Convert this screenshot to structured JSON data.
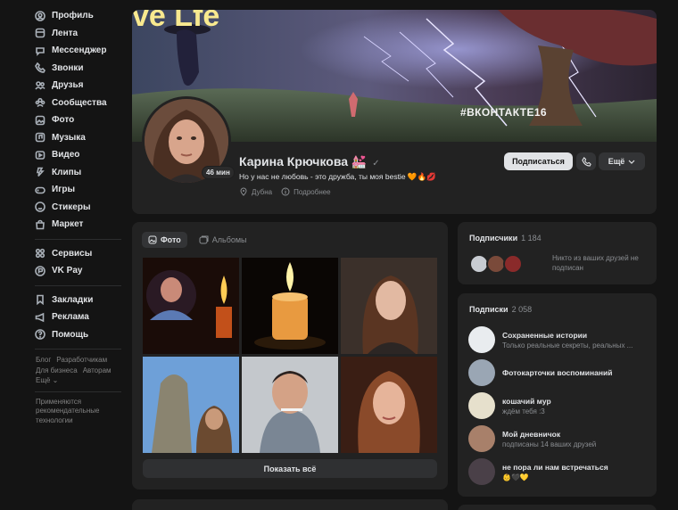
{
  "sidebar": {
    "items": [
      {
        "label": "Профиль",
        "icon": "user-circle-icon"
      },
      {
        "label": "Лента",
        "icon": "feed-icon"
      },
      {
        "label": "Мессенджер",
        "icon": "chat-icon"
      },
      {
        "label": "Звонки",
        "icon": "phone-icon"
      },
      {
        "label": "Друзья",
        "icon": "friends-icon"
      },
      {
        "label": "Сообщества",
        "icon": "communities-icon"
      },
      {
        "label": "Фото",
        "icon": "photo-icon"
      },
      {
        "label": "Музыка",
        "icon": "music-icon"
      },
      {
        "label": "Видео",
        "icon": "video-icon"
      },
      {
        "label": "Клипы",
        "icon": "clips-icon"
      },
      {
        "label": "Игры",
        "icon": "gamepad-icon"
      },
      {
        "label": "Стикеры",
        "icon": "sticker-icon"
      },
      {
        "label": "Маркет",
        "icon": "bag-icon"
      }
    ],
    "items2": [
      {
        "label": "Сервисы",
        "icon": "services-icon"
      },
      {
        "label": "VK Pay",
        "icon": "vkpay-icon"
      }
    ],
    "items3": [
      {
        "label": "Закладки",
        "icon": "bookmark-icon"
      },
      {
        "label": "Реклама",
        "icon": "megaphone-icon"
      },
      {
        "label": "Помощь",
        "icon": "help-icon"
      }
    ],
    "links": {
      "blog": "Блог",
      "developers": "Разработчикам",
      "business": "Для бизнеса",
      "authors": "Авторам",
      "more": "Ещё ⌄"
    },
    "note": "Применяются рекомендательные технологии"
  },
  "profile": {
    "cover_hashtag": "#ВКОНТАКТЕ16",
    "cover_text": "ve  Lfe",
    "online_badge": "46 мин",
    "name": "Карина Крючкова 💒",
    "verified_mark": "✓",
    "status": "Но у нас не любовь - это дружба, ты моя bestie 🧡🔥💋",
    "city": "Дубна",
    "details": "Подробнее",
    "subscribe_button": "Подписаться",
    "more_button": "Ещё"
  },
  "photos": {
    "tab_photos": "Фото",
    "tab_albums": "Альбомы",
    "show_all": "Показать всё"
  },
  "followers": {
    "title": "Подписчики",
    "count": "1 184",
    "note": "Никто из ваших друзей не подписан"
  },
  "subscriptions": {
    "title": "Подписки",
    "count": "2 058",
    "items": [
      {
        "title": "Сохраненные истории",
        "subtitle": "Только реальные секреты, реальных ..."
      },
      {
        "title": "Фотокарточки воспоминаний",
        "subtitle": ""
      },
      {
        "title": "кошачий мур",
        "subtitle": "ждём тебя :3"
      },
      {
        "title": "Мой дневничок",
        "subtitle": "подписаны 14 ваших друзей"
      },
      {
        "title": "не пора ли нам встречаться",
        "subtitle": "👶🖤💛"
      }
    ]
  },
  "colors": {
    "background": "#141414",
    "card": "#222222",
    "text": "#e1e3e6",
    "muted": "#8a8d91",
    "button_light": "#e1e3e6"
  }
}
